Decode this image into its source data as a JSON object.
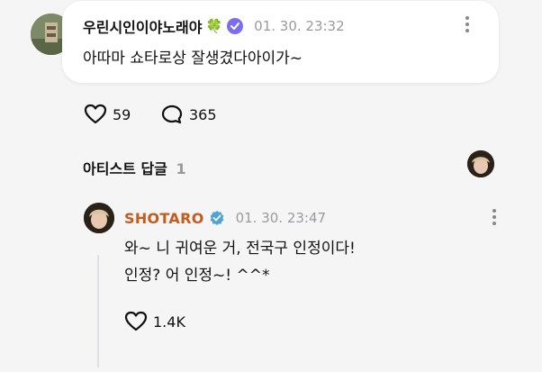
{
  "fan_comment": {
    "username": "우린시인이야노래야",
    "badge_emoji": "🍀",
    "timestamp": "01. 30. 23:32",
    "text": "아따마 쇼타로상 잘생겼다아이가~",
    "likes": "59",
    "replies": "365"
  },
  "artist_replies_section": {
    "title": "아티스트 답글",
    "count": "1"
  },
  "artist_reply": {
    "name": "SHOTARO",
    "timestamp": "01. 30. 23:47",
    "line1": "와~ 니 귀여운 거, 전국구 인정이다!",
    "line2": "인정? 어 인정~! ^^*",
    "likes": "1.4K"
  },
  "colors": {
    "artist_name": "#c85a1e",
    "badge": "#7b6ff0",
    "verified": "#4ea3d8",
    "timestamp": "#9a9aa0"
  },
  "icons": [
    "heart-icon",
    "speech-bubble-icon",
    "more-vertical-icon",
    "verified-icon",
    "clover-icon"
  ]
}
